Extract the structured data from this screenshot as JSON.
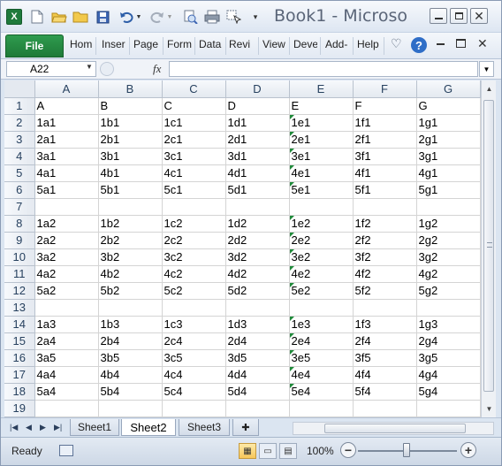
{
  "window": {
    "title": "Book1 - Microso"
  },
  "ribbon": {
    "file": "File",
    "tabs": [
      "Hom",
      "Inser",
      "Page",
      "Form",
      "Data",
      "Revi",
      "View",
      "Deve",
      "Add-",
      "Help"
    ]
  },
  "formula_bar": {
    "name_box": "A22",
    "fx": "fx",
    "value": ""
  },
  "grid": {
    "columns": [
      "A",
      "B",
      "C",
      "D",
      "E",
      "F",
      "G"
    ],
    "rows": [
      {
        "n": "1",
        "cells": [
          "A",
          "B",
          "C",
          "D",
          "E",
          "F",
          "G"
        ]
      },
      {
        "n": "2",
        "cells": [
          "1a1",
          "1b1",
          "1c1",
          "1d1",
          "1e1",
          "1f1",
          "1g1"
        ]
      },
      {
        "n": "3",
        "cells": [
          "2a1",
          "2b1",
          "2c1",
          "2d1",
          "2e1",
          "2f1",
          "2g1"
        ]
      },
      {
        "n": "4",
        "cells": [
          "3a1",
          "3b1",
          "3c1",
          "3d1",
          "3e1",
          "3f1",
          "3g1"
        ]
      },
      {
        "n": "5",
        "cells": [
          "4a1",
          "4b1",
          "4c1",
          "4d1",
          "4e1",
          "4f1",
          "4g1"
        ]
      },
      {
        "n": "6",
        "cells": [
          "5a1",
          "5b1",
          "5c1",
          "5d1",
          "5e1",
          "5f1",
          "5g1"
        ]
      },
      {
        "n": "7",
        "cells": [
          "",
          "",
          "",
          "",
          "",
          "",
          ""
        ]
      },
      {
        "n": "8",
        "cells": [
          "1a2",
          "1b2",
          "1c2",
          "1d2",
          "1e2",
          "1f2",
          "1g2"
        ]
      },
      {
        "n": "9",
        "cells": [
          "2a2",
          "2b2",
          "2c2",
          "2d2",
          "2e2",
          "2f2",
          "2g2"
        ]
      },
      {
        "n": "10",
        "cells": [
          "3a2",
          "3b2",
          "3c2",
          "3d2",
          "3e2",
          "3f2",
          "3g2"
        ]
      },
      {
        "n": "11",
        "cells": [
          "4a2",
          "4b2",
          "4c2",
          "4d2",
          "4e2",
          "4f2",
          "4g2"
        ]
      },
      {
        "n": "12",
        "cells": [
          "5a2",
          "5b2",
          "5c2",
          "5d2",
          "5e2",
          "5f2",
          "5g2"
        ]
      },
      {
        "n": "13",
        "cells": [
          "",
          "",
          "",
          "",
          "",
          "",
          ""
        ]
      },
      {
        "n": "14",
        "cells": [
          "1a3",
          "1b3",
          "1c3",
          "1d3",
          "1e3",
          "1f3",
          "1g3"
        ]
      },
      {
        "n": "15",
        "cells": [
          "2a4",
          "2b4",
          "2c4",
          "2d4",
          "2e4",
          "2f4",
          "2g4"
        ]
      },
      {
        "n": "16",
        "cells": [
          "3a5",
          "3b5",
          "3c5",
          "3d5",
          "3e5",
          "3f5",
          "3g5"
        ]
      },
      {
        "n": "17",
        "cells": [
          "4a4",
          "4b4",
          "4c4",
          "4d4",
          "4e4",
          "4f4",
          "4g4"
        ]
      },
      {
        "n": "18",
        "cells": [
          "5a4",
          "5b4",
          "5c4",
          "5d4",
          "5e4",
          "5f4",
          "5g4"
        ]
      },
      {
        "n": "19",
        "cells": [
          "",
          "",
          "",
          "",
          "",
          "",
          ""
        ]
      }
    ],
    "number_as_text_flag_column": "E"
  },
  "sheet_tabs": [
    {
      "label": "Sheet1",
      "active": false
    },
    {
      "label": "Sheet2",
      "active": true
    },
    {
      "label": "Sheet3",
      "active": false
    }
  ],
  "status_bar": {
    "ready": "Ready",
    "zoom": "100%"
  },
  "icons": {
    "qat": [
      "excel-logo-icon",
      "new-file-icon",
      "open-folder-icon",
      "folder-icon",
      "save-icon",
      "undo-icon",
      "redo-icon",
      "print-preview-icon",
      "print-icon",
      "select-icon",
      "customize-qat-icon"
    ],
    "window": [
      "minimize-icon",
      "restore-icon",
      "close-icon"
    ]
  },
  "colors": {
    "file_tab": "#1e7a38",
    "flag": "#1f8a3a",
    "header_text": "#27415f"
  }
}
